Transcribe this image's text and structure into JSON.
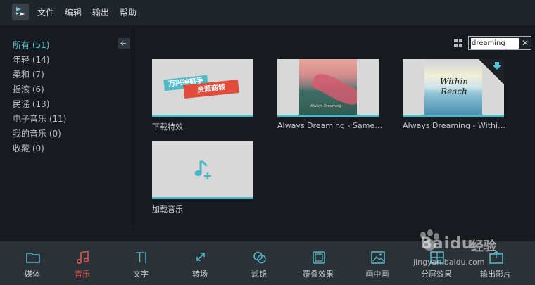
{
  "menubar": {
    "items": [
      "文件",
      "编辑",
      "输出",
      "帮助"
    ]
  },
  "sidebar": {
    "collapse_icon": "arrow-left-icon",
    "items": [
      {
        "label": "所有 (51)",
        "active": true
      },
      {
        "label": "年轻 (14)",
        "active": false
      },
      {
        "label": "柔和 (7)",
        "active": false
      },
      {
        "label": "摇滚 (6)",
        "active": false
      },
      {
        "label": "民谣 (13)",
        "active": false
      },
      {
        "label": "电子音乐 (11)",
        "active": false
      },
      {
        "label": "我的音乐 (0)",
        "active": false
      },
      {
        "label": "收藏 (0)",
        "active": false
      }
    ]
  },
  "toolbar": {
    "view_icon": "grid-view-icon",
    "search": {
      "value": "dreaming",
      "clear_icon": "close-icon"
    }
  },
  "cards": [
    {
      "label": "下载特效",
      "banner_top": "万兴神剪手",
      "banner_bottom": "资源商城"
    },
    {
      "label": "Always Dreaming - Same ...",
      "art_caption": "Always Dreaming"
    },
    {
      "label": "Always Dreaming - Within ...",
      "art_text": "Within Reach",
      "badge_icon": "download-icon"
    },
    {
      "label": "加载音乐",
      "icon": "music-add-icon"
    }
  ],
  "bottom_tools": [
    {
      "label": "媒体",
      "icon": "folder-icon",
      "active": false
    },
    {
      "label": "音乐",
      "icon": "music-note-icon",
      "active": true
    },
    {
      "label": "文字",
      "icon": "text-icon",
      "active": false
    },
    {
      "label": "转场",
      "icon": "transition-icon",
      "active": false
    },
    {
      "label": "滤镜",
      "icon": "filter-icon",
      "active": false
    },
    {
      "label": "覆叠效果",
      "icon": "overlay-icon",
      "active": false
    },
    {
      "label": "画中画",
      "icon": "picture-in-picture-icon",
      "active": false
    },
    {
      "label": "分屏效果",
      "icon": "split-screen-icon",
      "active": false
    },
    {
      "label": "输出影片",
      "icon": "export-icon",
      "active": false
    }
  ],
  "watermark": {
    "logo_text": "Baidu",
    "name": "经验",
    "url": "jingyan.baidu.com"
  },
  "colors": {
    "accent": "#4fb7c4",
    "active_tool": "#e0554a",
    "banner_blue": "#4fb8c6",
    "banner_red": "#e24c3a"
  }
}
